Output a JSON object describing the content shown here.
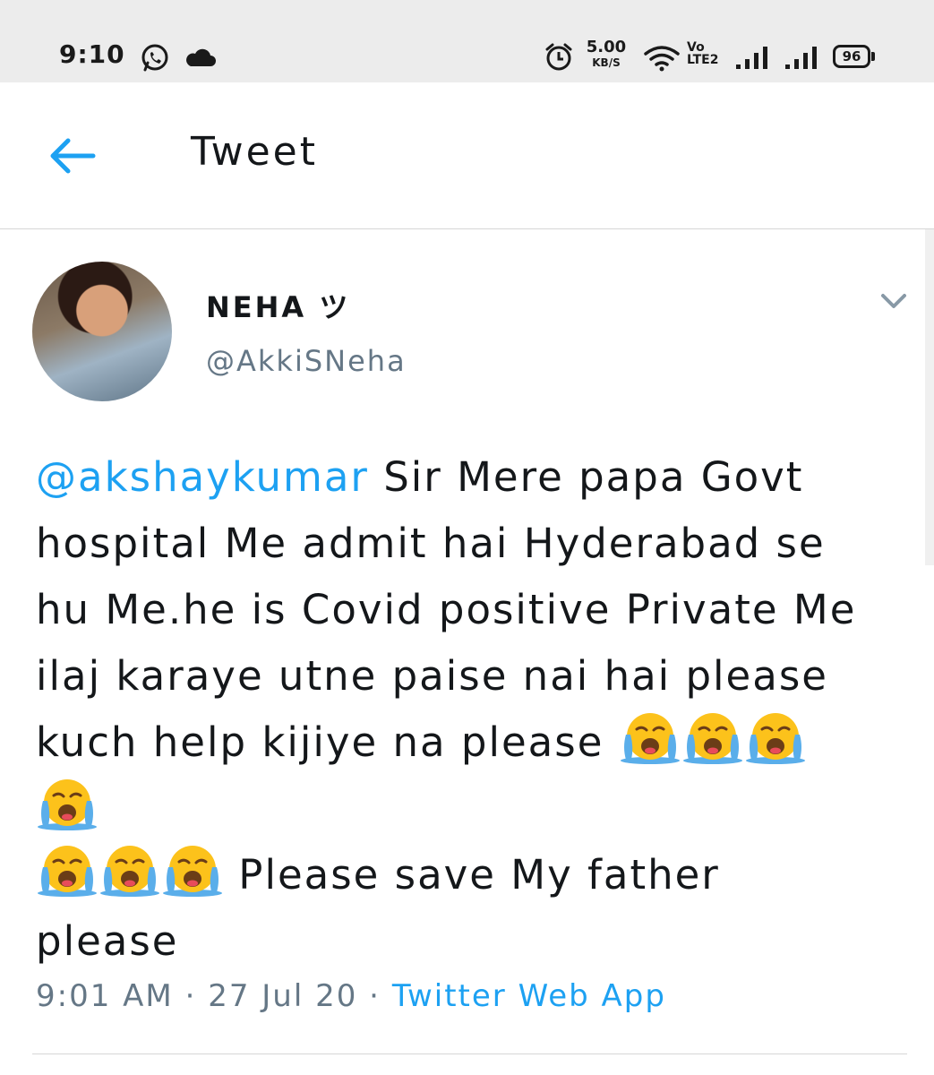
{
  "status_bar": {
    "time": "9:10",
    "network_speed": "5.00",
    "network_speed_unit": "KB/S",
    "volte_top": "Vo",
    "volte_bottom": "LTE2",
    "battery": "96",
    "icons": [
      "whatsapp-icon",
      "cloud-icon",
      "alarm-icon",
      "wifi-icon",
      "signal-icon",
      "signal-icon",
      "battery-icon"
    ]
  },
  "header": {
    "back_icon": "arrow-left-icon",
    "title": "Tweet"
  },
  "tweet": {
    "author_name": "NEHA ツ",
    "author_handle": "@AkkiSNeha",
    "menu_icon": "chevron-down-icon",
    "mention": "@akshaykumar",
    "text_1": " Sir Mere papa Govt hospital Me admit hai Hyderabad se hu Me.he is Covid positive Private Me ilaj karaye utne paise nai hai please kuch help kijiye na please ",
    "text_2": " Please save My father please",
    "emoji": "loudly-crying-face-icon",
    "emoji_count_first": 4,
    "emoji_count_second": 3,
    "time": "9:01 AM",
    "separator": " · ",
    "date": "27 Jul 20",
    "source": "Twitter Web App"
  },
  "colors": {
    "accent": "#1da1f2",
    "secondary_text": "#657786",
    "status_bar_bg": "#ececec"
  }
}
